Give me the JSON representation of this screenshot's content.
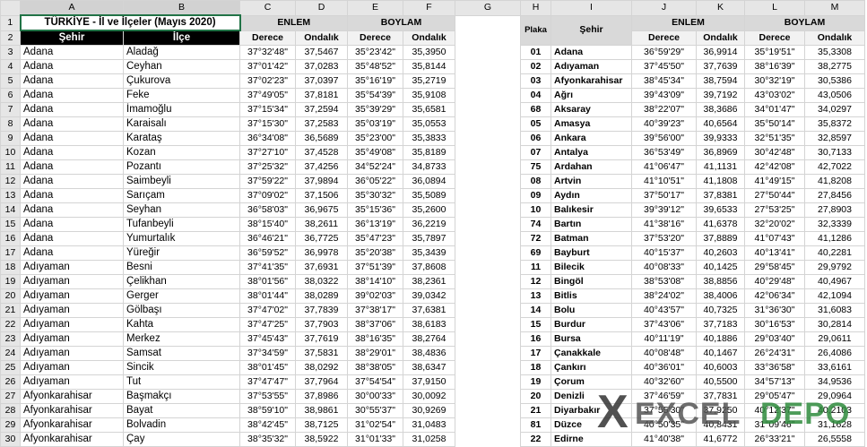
{
  "columns": [
    "A",
    "B",
    "C",
    "D",
    "E",
    "F",
    "G",
    "H",
    "I",
    "J",
    "K",
    "L",
    "M"
  ],
  "left": {
    "title": "TÜRKİYE - İl  ve  İlçeler  (Mayıs 2020)",
    "enlem": "ENLEM",
    "boylam": "BOYLAM",
    "sehir": "Şehir",
    "ilce": "İlçe",
    "derece": "Derece",
    "ondalik": "Ondalık",
    "rows": [
      [
        "3",
        "Adana",
        "Aladağ",
        "37°32'48\"",
        "37,5467",
        "35°23'42\"",
        "35,3950"
      ],
      [
        "4",
        "Adana",
        "Ceyhan",
        "37°01'42\"",
        "37,0283",
        "35°48'52\"",
        "35,8144"
      ],
      [
        "5",
        "Adana",
        "Çukurova",
        "37°02'23\"",
        "37,0397",
        "35°16'19\"",
        "35,2719"
      ],
      [
        "6",
        "Adana",
        "Feke",
        "37°49'05\"",
        "37,8181",
        "35°54'39\"",
        "35,9108"
      ],
      [
        "7",
        "Adana",
        "İmamoğlu",
        "37°15'34\"",
        "37,2594",
        "35°39'29\"",
        "35,6581"
      ],
      [
        "8",
        "Adana",
        "Karaisalı",
        "37°15'30\"",
        "37,2583",
        "35°03'19\"",
        "35,0553"
      ],
      [
        "9",
        "Adana",
        "Karataş",
        "36°34'08\"",
        "36,5689",
        "35°23'00\"",
        "35,3833"
      ],
      [
        "10",
        "Adana",
        "Kozan",
        "37°27'10\"",
        "37,4528",
        "35°49'08\"",
        "35,8189"
      ],
      [
        "11",
        "Adana",
        "Pozantı",
        "37°25'32\"",
        "37,4256",
        "34°52'24\"",
        "34,8733"
      ],
      [
        "12",
        "Adana",
        "Saimbeyli",
        "37°59'22\"",
        "37,9894",
        "36°05'22\"",
        "36,0894"
      ],
      [
        "13",
        "Adana",
        "Sarıçam",
        "37°09'02\"",
        "37,1506",
        "35°30'32\"",
        "35,5089"
      ],
      [
        "14",
        "Adana",
        "Seyhan",
        "36°58'03\"",
        "36,9675",
        "35°15'36\"",
        "35,2600"
      ],
      [
        "15",
        "Adana",
        "Tufanbeyli",
        "38°15'40\"",
        "38,2611",
        "36°13'19\"",
        "36,2219"
      ],
      [
        "16",
        "Adana",
        "Yumurtalık",
        "36°46'21\"",
        "36,7725",
        "35°47'23\"",
        "35,7897"
      ],
      [
        "17",
        "Adana",
        "Yüreğir",
        "36°59'52\"",
        "36,9978",
        "35°20'38\"",
        "35,3439"
      ],
      [
        "18",
        "Adıyaman",
        "Besni",
        "37°41'35\"",
        "37,6931",
        "37°51'39\"",
        "37,8608"
      ],
      [
        "19",
        "Adıyaman",
        "Çelikhan",
        "38°01'56\"",
        "38,0322",
        "38°14'10\"",
        "38,2361"
      ],
      [
        "20",
        "Adıyaman",
        "Gerger",
        "38°01'44\"",
        "38,0289",
        "39°02'03\"",
        "39,0342"
      ],
      [
        "21",
        "Adıyaman",
        "Gölbaşı",
        "37°47'02\"",
        "37,7839",
        "37°38'17\"",
        "37,6381"
      ],
      [
        "22",
        "Adıyaman",
        "Kahta",
        "37°47'25\"",
        "37,7903",
        "38°37'06\"",
        "38,6183"
      ],
      [
        "23",
        "Adıyaman",
        "Merkez",
        "37°45'43\"",
        "37,7619",
        "38°16'35\"",
        "38,2764"
      ],
      [
        "24",
        "Adıyaman",
        "Samsat",
        "37°34'59\"",
        "37,5831",
        "38°29'01\"",
        "38,4836"
      ],
      [
        "25",
        "Adıyaman",
        "Sincik",
        "38°01'45\"",
        "38,0292",
        "38°38'05\"",
        "38,6347"
      ],
      [
        "26",
        "Adıyaman",
        "Tut",
        "37°47'47\"",
        "37,7964",
        "37°54'54\"",
        "37,9150"
      ],
      [
        "27",
        "Afyonkarahisar",
        "Başmakçı",
        "37°53'55\"",
        "37,8986",
        "30°00'33\"",
        "30,0092"
      ],
      [
        "28",
        "Afyonkarahisar",
        "Bayat",
        "38°59'10\"",
        "38,9861",
        "30°55'37\"",
        "30,9269"
      ],
      [
        "29",
        "Afyonkarahisar",
        "Bolvadin",
        "38°42'45\"",
        "38,7125",
        "31°02'54\"",
        "31,0483"
      ],
      [
        "30",
        "Afyonkarahisar",
        "Çay",
        "38°35'32\"",
        "38,5922",
        "31°01'33\"",
        "31,0258"
      ]
    ]
  },
  "right": {
    "plaka": "Plaka",
    "sehir": "Şehir",
    "enlem": "ENLEM",
    "boylam": "BOYLAM",
    "derece": "Derece",
    "ondalik": "Ondalık",
    "rows": [
      [
        "01",
        "Adana",
        "36°59'29\"",
        "36,9914",
        "35°19'51\"",
        "35,3308"
      ],
      [
        "02",
        "Adıyaman",
        "37°45'50\"",
        "37,7639",
        "38°16'39\"",
        "38,2775"
      ],
      [
        "03",
        "Afyonkarahisar",
        "38°45'34\"",
        "38,7594",
        "30°32'19\"",
        "30,5386"
      ],
      [
        "04",
        "Ağrı",
        "39°43'09\"",
        "39,7192",
        "43°03'02\"",
        "43,0506"
      ],
      [
        "68",
        "Aksaray",
        "38°22'07\"",
        "38,3686",
        "34°01'47\"",
        "34,0297"
      ],
      [
        "05",
        "Amasya",
        "40°39'23\"",
        "40,6564",
        "35°50'14\"",
        "35,8372"
      ],
      [
        "06",
        "Ankara",
        "39°56'00\"",
        "39,9333",
        "32°51'35\"",
        "32,8597"
      ],
      [
        "07",
        "Antalya",
        "36°53'49\"",
        "36,8969",
        "30°42'48\"",
        "30,7133"
      ],
      [
        "75",
        "Ardahan",
        "41°06'47\"",
        "41,1131",
        "42°42'08\"",
        "42,7022"
      ],
      [
        "08",
        "Artvin",
        "41°10'51\"",
        "41,1808",
        "41°49'15\"",
        "41,8208"
      ],
      [
        "09",
        "Aydın",
        "37°50'17\"",
        "37,8381",
        "27°50'44\"",
        "27,8456"
      ],
      [
        "10",
        "Balıkesir",
        "39°39'12\"",
        "39,6533",
        "27°53'25\"",
        "27,8903"
      ],
      [
        "74",
        "Bartın",
        "41°38'16\"",
        "41,6378",
        "32°20'02\"",
        "32,3339"
      ],
      [
        "72",
        "Batman",
        "37°53'20\"",
        "37,8889",
        "41°07'43\"",
        "41,1286"
      ],
      [
        "69",
        "Bayburt",
        "40°15'37\"",
        "40,2603",
        "40°13'41\"",
        "40,2281"
      ],
      [
        "11",
        "Bilecik",
        "40°08'33\"",
        "40,1425",
        "29°58'45\"",
        "29,9792"
      ],
      [
        "12",
        "Bingöl",
        "38°53'08\"",
        "38,8856",
        "40°29'48\"",
        "40,4967"
      ],
      [
        "13",
        "Bitlis",
        "38°24'02\"",
        "38,4006",
        "42°06'34\"",
        "42,1094"
      ],
      [
        "14",
        "Bolu",
        "40°43'57\"",
        "40,7325",
        "31°36'30\"",
        "31,6083"
      ],
      [
        "15",
        "Burdur",
        "37°43'06\"",
        "37,7183",
        "30°16'53\"",
        "30,2814"
      ],
      [
        "16",
        "Bursa",
        "40°11'19\"",
        "40,1886",
        "29°03'40\"",
        "29,0611"
      ],
      [
        "17",
        "Çanakkale",
        "40°08'48\"",
        "40,1467",
        "26°24'31\"",
        "26,4086"
      ],
      [
        "18",
        "Çankırı",
        "40°36'01\"",
        "40,6003",
        "33°36'58\"",
        "33,6161"
      ],
      [
        "19",
        "Çorum",
        "40°32'60\"",
        "40,5500",
        "34°57'13\"",
        "34,9536"
      ],
      [
        "20",
        "Denizli",
        "37°46'59\"",
        "37,7831",
        "29°05'47\"",
        "29,0964"
      ],
      [
        "21",
        "Diyarbakır",
        "37°55'30\"",
        "37,9250",
        "40°12'37\"",
        "40,2103"
      ],
      [
        "81",
        "Düzce",
        "40°50'35\"",
        "40,8431",
        "31°09'46\"",
        "31,1628"
      ],
      [
        "22",
        "Edirne",
        "41°40'38\"",
        "41,6772",
        "26°33'21\"",
        "26,5558"
      ]
    ]
  },
  "watermark": {
    "mark": "X",
    "part1": "EXCEL",
    "part2": "DEPO"
  }
}
